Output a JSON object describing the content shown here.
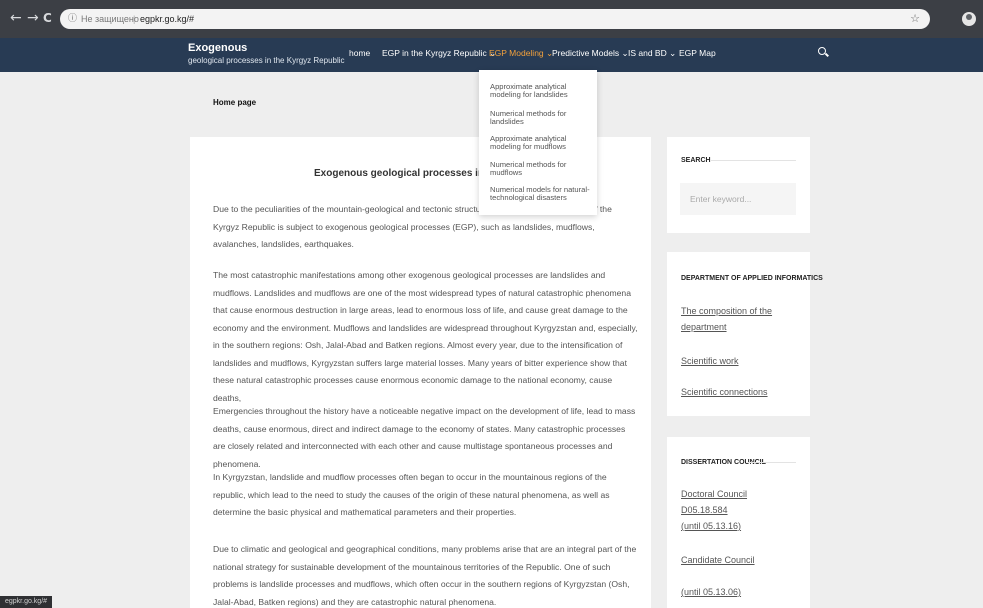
{
  "browser": {
    "back_glyph": "←",
    "forward_glyph": "→",
    "reload_glyph": "C",
    "info_glyph": "ⓘ",
    "security_text": "Не защищено",
    "separator": "|",
    "url": "egpkr.go.kg/#",
    "bookmark_glyph": "☆"
  },
  "site": {
    "title": "Exogenous",
    "subtitle": "geological processes in the Kyrgyz Republic"
  },
  "menu": [
    {
      "label": "home"
    },
    {
      "label": "EGP in the Kyrgyz Republic ⌄"
    },
    {
      "label": "EGP Modeling ⌄"
    },
    {
      "label": "Predictive Models ⌄"
    },
    {
      "label": "IS and BD ⌄"
    },
    {
      "label": "EGP Map"
    }
  ],
  "dropdown": [
    {
      "label": "Approximate analytical modeling for landslides"
    },
    {
      "label": "Numerical methods for landslides"
    },
    {
      "label": "Approximate analytical modeling for mudflows"
    },
    {
      "label": "Numerical methods for mudflows"
    },
    {
      "label": "Numerical models for natural-technological disasters"
    }
  ],
  "breadcrumb": "Home page",
  "article": {
    "title": "Exogenous geological processes in the Kyr",
    "paragraphs": [
      "Due to the peculiarities of the mountain-geological and tectonic structure, almost the entire territory of the Kyrgyz Republic is subject to exogenous geological processes (EGP), such as landslides, mudflows, avalanches, landslides, earthquakes.",
      "The most catastrophic manifestations among other exogenous geological processes are landslides and mudflows. Landslides and mudflows are one of the most widespread types of natural catastrophic phenomena that cause enormous destruction in large areas, lead to enormous loss of life, and cause great damage to the economy and the environment. Mudflows and landslides are widespread throughout Kyrgyzstan and, especially, in the southern regions: Osh, Jalal-Abad and Batken regions. Almost every year, due to the intensification of landslides and mudflows, Kyrgyzstan suffers large material losses. Many years of bitter experience show that these natural catastrophic processes cause enormous economic damage to the national economy, cause deaths,",
      "Emergencies throughout the history have a noticeable negative impact on the development of life, lead to mass deaths, cause enormous, direct and indirect damage to the economy of states. Many catastrophic processes are closely related and interconnected with each other and cause multistage spontaneous processes and phenomena.",
      "In Kyrgyzstan, landslide and mudflow processes often began to occur in the mountainous regions of the republic, which lead to the need to study the causes of the origin of these natural phenomena, as well as determine the basic physical and mathematical parameters and their properties.",
      "Due to climatic and geological and geographical conditions, many problems arise that are an integral part of the national strategy for sustainable development of the mountainous territories of the Republic. One of such problems is landslide processes and mudflows, which often occur in the southern regions of Kyrgyzstan (Osh, Jalal-Abad, Batken regions) and they are catastrophic natural phenomena."
    ]
  },
  "sidebar": {
    "search_title": "SEARCH",
    "search_placeholder": "Enter keyword...",
    "dept_title": "DEPARTMENT OF APPLIED INFORMATICS",
    "dept_links": [
      "The composition of the department",
      "Scientific work",
      "Scientific connections"
    ],
    "council_title": "DISSERTATION COUNCIL",
    "council_links": [
      "Doctoral Council D05.18.584",
      "(until 05.13.16)",
      "Candidate Council",
      "(until 05.13.06)"
    ]
  },
  "status_url": "egpkr.go.kg/#"
}
